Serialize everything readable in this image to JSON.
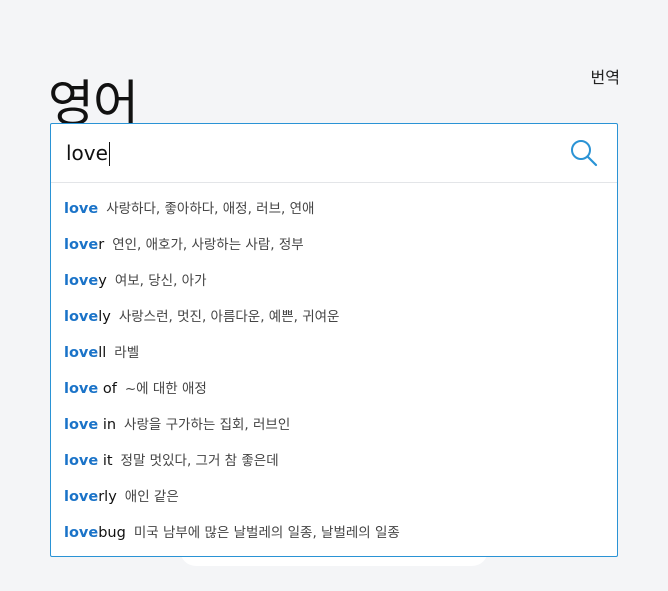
{
  "header": {
    "title": "영어",
    "translate_link": "번역"
  },
  "search": {
    "value": "love",
    "placeholder": ""
  },
  "suggestions": [
    {
      "match": "love",
      "rest": "",
      "meaning": "사랑하다, 좋아하다, 애정, 러브, 연애"
    },
    {
      "match": "love",
      "rest": "r",
      "meaning": "연인, 애호가, 사랑하는 사람, 정부"
    },
    {
      "match": "love",
      "rest": "y",
      "meaning": "여보, 당신, 아가"
    },
    {
      "match": "love",
      "rest": "ly",
      "meaning": "사랑스런, 멋진, 아름다운, 예쁜, 귀여운"
    },
    {
      "match": "love",
      "rest": "ll",
      "meaning": "라벨"
    },
    {
      "match": "love",
      "rest": " of",
      "meaning": "~에 대한 애정"
    },
    {
      "match": "love",
      "rest": " in",
      "meaning": "사랑을 구가하는 집회, 러브인"
    },
    {
      "match": "love",
      "rest": " it",
      "meaning": "정말 멋있다, 그거 참 좋은데"
    },
    {
      "match": "love",
      "rest": "rly",
      "meaning": "애인 같은"
    },
    {
      "match": "love",
      "rest": "bug",
      "meaning": "미국 남부에 많은 날벌레의 일종, 날벌레의 일종"
    }
  ],
  "icons": {
    "search": "search-icon"
  },
  "colors": {
    "accent": "#2a93d5",
    "match": "#1a73c8",
    "background": "#f4f5f7"
  }
}
